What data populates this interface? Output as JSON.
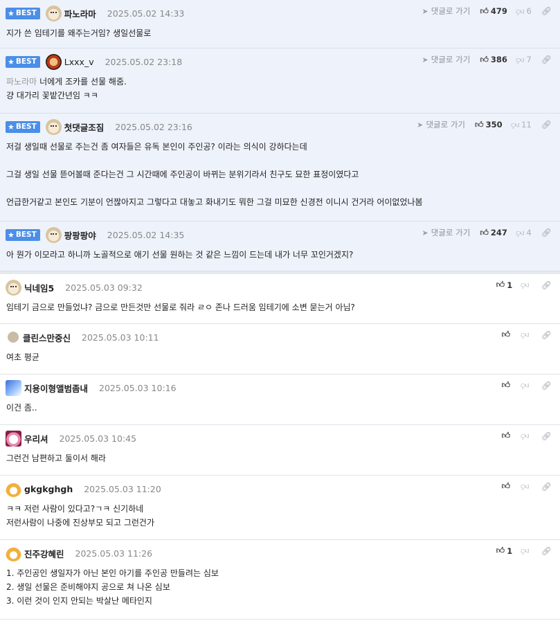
{
  "best_badge": "BEST",
  "goto_label": "댓글로 가기",
  "comments": [
    {
      "nick": "파노라마",
      "date": "2025.05.02 14:33",
      "likes": "479",
      "dislikes": "6",
      "lines": [
        "지가 쓴 임테기를 왜주는거임? 생일선물로"
      ]
    },
    {
      "nick": "Lxxx_v",
      "date": "2025.05.02 23:18",
      "likes": "386",
      "dislikes": "7",
      "mention": "파노라마",
      "lines": [
        "너에게 조카를 선물 해줌.",
        "걍 대가리 꽃밭간년임 ㅋㅋ"
      ]
    },
    {
      "nick": "첫댓글조짐",
      "date": "2025.05.02 23:16",
      "likes": "350",
      "dislikes": "11",
      "lines": [
        "저걸 생일때 선물로 주는건 좀 여자들은 유독 본인이 주인공? 이라는 의식이 강하다는데",
        "",
        "그걸 생일 선물 뜯어볼때 준다는건 그 시간때에 주인공이 바뀌는 분위기라서 친구도 묘한 표정이였다고",
        "",
        "언급한거같고 본인도 기분이 언짢아지고 그렇다고 대놓고 화내기도 뭐한 그걸 미묘한 신경전 이니시 건거라 어이없었나봄"
      ]
    },
    {
      "nick": "팡팡팡야",
      "date": "2025.05.02 14:35",
      "likes": "247",
      "dislikes": "4",
      "lines": [
        "아 뭔가 이모라고 하니까 노골적으로 애기 선물 원하는 것 같은 느낌이 드는데 내가 너무 꼬인거겠지?"
      ]
    },
    {
      "nick": "닉네임5",
      "date": "2025.05.03 09:32",
      "likes": "1",
      "dislikes": "",
      "lines": [
        "임테기 금으로 만들었냐? 금으로 만든것만 선물로 줘라 ㄹㅇ 존나 드러움 임테기에 소변 묻는거 아님?"
      ]
    },
    {
      "nick": "클린스만중신",
      "date": "2025.05.03 10:11",
      "likes": "",
      "dislikes": "",
      "lines": [
        "여초 평균"
      ]
    },
    {
      "nick": "지용이형앨범좀내",
      "date": "2025.05.03 10:16",
      "likes": "",
      "dislikes": "",
      "lines": [
        "이건 좀.."
      ]
    },
    {
      "nick": "우리셔",
      "date": "2025.05.03 10:45",
      "likes": "",
      "dislikes": "",
      "lines": [
        "그런건 남편하고 둘이서 해라"
      ]
    },
    {
      "nick": "gkgkghgh",
      "date": "2025.05.03 11:20",
      "likes": "",
      "dislikes": "",
      "lines": [
        "ㅋㅋ 저런 사람이 있다고?ㄱㅋ 신기하네",
        "저런사람이 나중에 진상부모 되고 그런건가"
      ]
    },
    {
      "nick": "진주강혜린",
      "date": "2025.05.03 11:26",
      "likes": "1",
      "dislikes": "",
      "lines": [
        "1. 주인공인 생일자가 아닌 본인 아기를 주인공 만들려는 심보",
        "2. 생일 선물은 준비해야지 공으로 쳐 나온 심보",
        "3. 이런 것이 인지 안되는 박살난 메타인지"
      ]
    }
  ]
}
